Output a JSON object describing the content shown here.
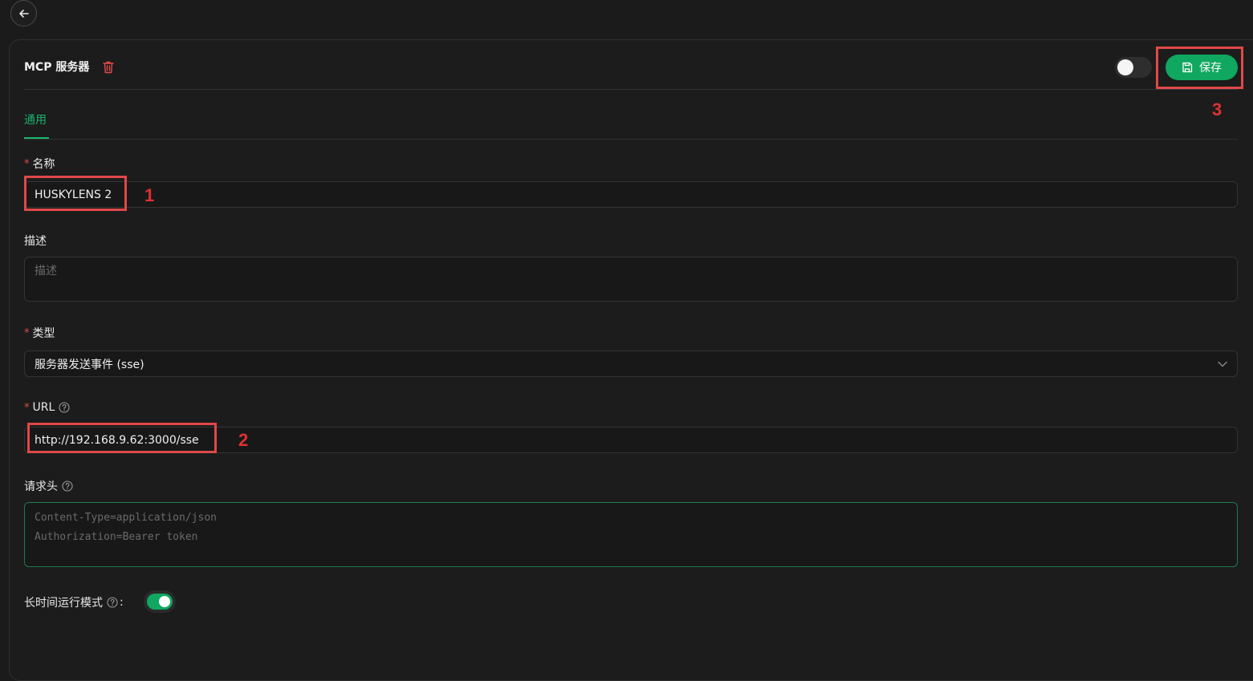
{
  "header": {
    "title": "MCP 服务器",
    "save_label": "保存",
    "enabled": false
  },
  "tabs": [
    {
      "label": "通用",
      "active": true
    }
  ],
  "form": {
    "name": {
      "label": "名称",
      "required": true,
      "value": "HUSKYLENS 2"
    },
    "description": {
      "label": "描述",
      "required": false,
      "placeholder": "描述"
    },
    "type": {
      "label": "类型",
      "required": true,
      "value": "服务器发送事件 (sse)"
    },
    "url": {
      "label": "URL",
      "required": true,
      "value": "http://192.168.9.62:3000/sse"
    },
    "headers": {
      "label": "请求头",
      "placeholder_line1": "Content-Type=application/json",
      "placeholder_line2": "Authorization=Bearer token"
    },
    "long_running": {
      "label": "长时间运行模式",
      "suffix": ":",
      "enabled": true
    }
  },
  "annotations": [
    "1",
    "2",
    "3"
  ],
  "colors": {
    "accent": "#10a760",
    "annotation": "#e04848",
    "required": "#e04a4a"
  },
  "icons": [
    "back-arrow-icon",
    "trash-icon",
    "save-icon",
    "help-icon",
    "chevron-down-icon"
  ]
}
